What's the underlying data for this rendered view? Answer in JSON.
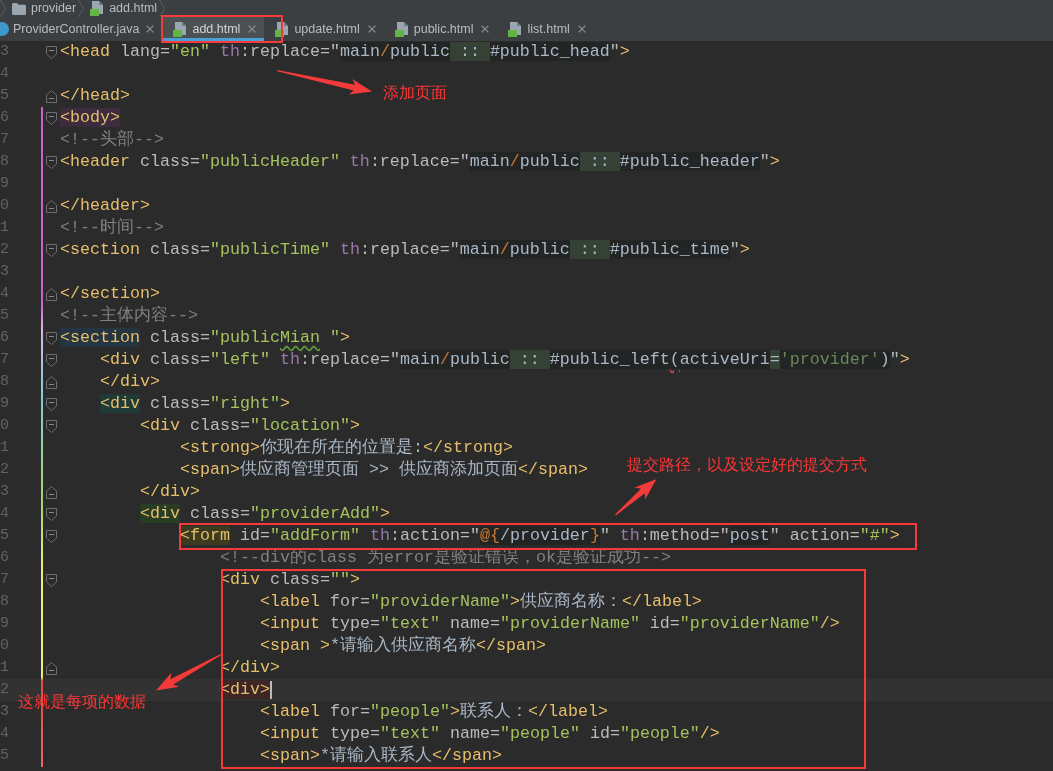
{
  "breadcrumb": [
    {
      "label": "provider",
      "kind": "folder"
    },
    {
      "label": "add.html",
      "kind": "html"
    }
  ],
  "tabs": [
    {
      "label": "ProviderController.java",
      "kind": "class",
      "selected": false
    },
    {
      "label": "add.html",
      "kind": "html",
      "selected": true
    },
    {
      "label": "update.html",
      "kind": "html",
      "selected": false
    },
    {
      "label": "public.html",
      "kind": "html",
      "selected": false
    },
    {
      "label": "list.html",
      "kind": "html",
      "selected": false
    }
  ],
  "editor": {
    "lines": [
      {
        "number": "3",
        "fold_marker": {
          "kind": "start"
        },
        "current": false,
        "segments": [
          {
            "kind": "tag",
            "text": "<head"
          },
          {
            "kind": "attr",
            "text": " lang="
          },
          {
            "kind": "str",
            "text": "\"en\""
          },
          {
            "kind": "ns",
            "text": " th"
          },
          {
            "kind": "attr",
            "text": ":replace=\""
          },
          {
            "kind": "expr",
            "text": "main"
          },
          {
            "kind": "kw",
            "text": "/"
          },
          {
            "kind": "expr",
            "text": "public"
          },
          {
            "kind": "op",
            "text": " :: "
          },
          {
            "kind": "expr",
            "text": "#public_head"
          },
          {
            "kind": "attr",
            "text": "\""
          },
          {
            "kind": "tag",
            "text": ">"
          }
        ]
      },
      {
        "number": "4",
        "current": false
      },
      {
        "number": "5",
        "fold_marker": {
          "kind": "end"
        },
        "current": false,
        "segments": [
          {
            "kind": "tag",
            "text": "</head>"
          }
        ]
      },
      {
        "number": "6",
        "fold_marker": {
          "kind": "start"
        },
        "current": false,
        "segments": [
          {
            "kind": "tagmark",
            "text": "<body>",
            "color": "#3d2b3e"
          }
        ]
      },
      {
        "number": "7",
        "current": false,
        "segments": [
          {
            "kind": "comment",
            "text": "<!--头部-->"
          }
        ]
      },
      {
        "number": "8",
        "fold_marker": {
          "kind": "start"
        },
        "current": false,
        "segments": [
          {
            "kind": "tag",
            "text": "<header"
          },
          {
            "kind": "attr",
            "text": " class="
          },
          {
            "kind": "str",
            "text": "\"publicHeader\""
          },
          {
            "kind": "ns",
            "text": " th"
          },
          {
            "kind": "attr",
            "text": ":replace=\""
          },
          {
            "kind": "expr",
            "text": "main"
          },
          {
            "kind": "kw",
            "text": "/"
          },
          {
            "kind": "expr",
            "text": "public"
          },
          {
            "kind": "op",
            "text": " :: "
          },
          {
            "kind": "expr",
            "text": "#public_header"
          },
          {
            "kind": "attr",
            "text": "\""
          },
          {
            "kind": "tag",
            "text": ">"
          }
        ]
      },
      {
        "number": "9",
        "current": false
      },
      {
        "number": "0",
        "fold_marker": {
          "kind": "end"
        },
        "current": false,
        "segments": [
          {
            "kind": "tag",
            "text": "</header>"
          }
        ]
      },
      {
        "number": "1",
        "current": false,
        "segments": [
          {
            "kind": "comment",
            "text": "<!--时间-->"
          }
        ]
      },
      {
        "number": "2",
        "fold_marker": {
          "kind": "start"
        },
        "current": false,
        "segments": [
          {
            "kind": "tag",
            "text": "<section"
          },
          {
            "kind": "attr",
            "text": " class="
          },
          {
            "kind": "str",
            "text": "\"publicTime\""
          },
          {
            "kind": "ns",
            "text": " th"
          },
          {
            "kind": "attr",
            "text": ":replace=\""
          },
          {
            "kind": "expr",
            "text": "main"
          },
          {
            "kind": "kw",
            "text": "/"
          },
          {
            "kind": "expr",
            "text": "public"
          },
          {
            "kind": "op",
            "text": " :: "
          },
          {
            "kind": "expr",
            "text": "#public_time"
          },
          {
            "kind": "attr",
            "text": "\""
          },
          {
            "kind": "tag",
            "text": ">"
          }
        ]
      },
      {
        "number": "3",
        "current": false
      },
      {
        "number": "4",
        "fold_marker": {
          "kind": "end"
        },
        "current": false,
        "segments": [
          {
            "kind": "tag",
            "text": "</section>"
          }
        ]
      },
      {
        "number": "5",
        "current": false,
        "segments": [
          {
            "kind": "comment",
            "text": "<!--主体内容-->"
          }
        ]
      },
      {
        "number": "6",
        "fold_marker": {
          "kind": "start"
        },
        "current": false,
        "segments": [
          {
            "kind": "tagmark",
            "text": "<section",
            "color": "#263542"
          },
          {
            "kind": "attr",
            "text": " class="
          },
          {
            "kind": "str",
            "text": "\"public"
          },
          {
            "kind": "typo",
            "text": "Mian"
          },
          {
            "kind": "str",
            "text": " \""
          },
          {
            "kind": "tag",
            "text": ">"
          }
        ],
        "children": [
          {
            "number": "7",
            "fold_marker": {
              "kind": "start"
            },
            "current": false,
            "segments": [
              {
                "kind": "tag",
                "text": "<div"
              },
              {
                "kind": "attr",
                "text": " class="
              },
              {
                "kind": "str",
                "text": "\"left\""
              },
              {
                "kind": "ns",
                "text": " th"
              },
              {
                "kind": "attr",
                "text": ":replace=\""
              },
              {
                "kind": "expr",
                "text": "main"
              },
              {
                "kind": "kw",
                "text": "/"
              },
              {
                "kind": "expr",
                "text": "public"
              },
              {
                "kind": "op",
                "text": " :: "
              },
              {
                "kind": "expr",
                "text": "#public_left"
              },
              {
                "kind": "error",
                "text": "("
              },
              {
                "kind": "expr",
                "text": "activeUri"
              },
              {
                "kind": "op",
                "text": "="
              },
              {
                "kind": "sq",
                "text": "'provider'"
              },
              {
                "kind": "expr",
                "text": ")"
              },
              {
                "kind": "attr",
                "text": "\""
              },
              {
                "kind": "tag",
                "text": ">"
              }
            ]
          },
          {
            "number": "8",
            "fold_marker": {
              "kind": "end"
            },
            "current": false,
            "segments": [
              {
                "kind": "tag",
                "text": "</div>"
              }
            ]
          },
          {
            "number": "9",
            "fold_marker": {
              "kind": "start"
            },
            "current": false,
            "segments": [
              {
                "kind": "tagmark",
                "text": "<div",
                "color": "#1f3a37"
              },
              {
                "kind": "attr",
                "text": " class="
              },
              {
                "kind": "str",
                "text": "\"right\""
              },
              {
                "kind": "tag",
                "text": ">"
              }
            ],
            "children": [
              {
                "number": "0",
                "fold_marker": {
                  "kind": "start"
                },
                "current": false,
                "segments": [
                  {
                    "kind": "tag",
                    "text": "<div"
                  },
                  {
                    "kind": "attr",
                    "text": " class="
                  },
                  {
                    "kind": "str",
                    "text": "\"location\""
                  },
                  {
                    "kind": "tag",
                    "text": ">"
                  }
                ],
                "children": [
                  {
                    "number": "1",
                    "current": false,
                    "segments": [
                      {
                        "kind": "tag",
                        "text": "<strong>"
                      },
                      {
                        "kind": "text",
                        "text": "你现在所在的位置是:"
                      },
                      {
                        "kind": "tag",
                        "text": "</strong>"
                      }
                    ]
                  },
                  {
                    "number": "2",
                    "current": false,
                    "segments": [
                      {
                        "kind": "tag",
                        "text": "<span>"
                      },
                      {
                        "kind": "text",
                        "text": "供应商管理页面 >> 供应商添加页面"
                      },
                      {
                        "kind": "tag",
                        "text": "</span>"
                      }
                    ]
                  }
                ]
              },
              {
                "number": "3",
                "fold_marker": {
                  "kind": "end"
                },
                "current": false,
                "segments": [
                  {
                    "kind": "tag",
                    "text": "</div>"
                  }
                ]
              },
              {
                "number": "4",
                "fold_marker": {
                  "kind": "start"
                },
                "current": false,
                "segments": [
                  {
                    "kind": "tagmark",
                    "text": "<div",
                    "color": "#283d23"
                  },
                  {
                    "kind": "attr",
                    "text": " class="
                  },
                  {
                    "kind": "str",
                    "text": "\"providerAdd\""
                  },
                  {
                    "kind": "tag",
                    "text": ">"
                  }
                ],
                "children": [
                  {
                    "number": "5",
                    "fold_marker": {
                      "kind": "start"
                    },
                    "current": false,
                    "segments": [
                      {
                        "kind": "tagmark",
                        "text": "<form",
                        "color": "#3d3b1f"
                      },
                      {
                        "kind": "attr",
                        "text": " id="
                      },
                      {
                        "kind": "str",
                        "text": "\"addForm\""
                      },
                      {
                        "kind": "ns",
                        "text": " th"
                      },
                      {
                        "kind": "attr",
                        "text": ":action=\""
                      },
                      {
                        "kind": "kw",
                        "text": "@{"
                      },
                      {
                        "kind": "expr",
                        "text": "/provider"
                      },
                      {
                        "kind": "kw",
                        "text": "}"
                      },
                      {
                        "kind": "attr",
                        "text": "\""
                      },
                      {
                        "kind": "ns",
                        "text": " th"
                      },
                      {
                        "kind": "attr",
                        "text": ":method=\""
                      },
                      {
                        "kind": "expr",
                        "text": "post"
                      },
                      {
                        "kind": "attr",
                        "text": "\" action="
                      },
                      {
                        "kind": "str",
                        "text": "\"#\""
                      },
                      {
                        "kind": "tag",
                        "text": ">"
                      }
                    ],
                    "children": [
                      {
                        "number": "6",
                        "current": false,
                        "segments": [
                          {
                            "kind": "comment",
                            "text": "<!--div的class 为error是验证错误，ok是验证成功-->"
                          }
                        ]
                      },
                      {
                        "number": "7",
                        "fold_marker": {
                          "kind": "start"
                        },
                        "current": false,
                        "segments": [
                          {
                            "kind": "tag",
                            "text": "<div"
                          },
                          {
                            "kind": "attr",
                            "text": " class="
                          },
                          {
                            "kind": "str",
                            "text": "\"\""
                          },
                          {
                            "kind": "tag",
                            "text": ">"
                          }
                        ],
                        "children": [
                          {
                            "number": "8",
                            "current": false,
                            "segments": [
                              {
                                "kind": "tag",
                                "text": "<label"
                              },
                              {
                                "kind": "attr",
                                "text": " for="
                              },
                              {
                                "kind": "str",
                                "text": "\"providerName\""
                              },
                              {
                                "kind": "tag",
                                "text": ">"
                              },
                              {
                                "kind": "text",
                                "text": "供应商名称："
                              },
                              {
                                "kind": "tag",
                                "text": "</label>"
                              }
                            ]
                          },
                          {
                            "number": "9",
                            "current": false,
                            "segments": [
                              {
                                "kind": "tag",
                                "text": "<input"
                              },
                              {
                                "kind": "attr",
                                "text": " type="
                              },
                              {
                                "kind": "str",
                                "text": "\"text\""
                              },
                              {
                                "kind": "attr",
                                "text": " name="
                              },
                              {
                                "kind": "str",
                                "text": "\"providerName\""
                              },
                              {
                                "kind": "attr",
                                "text": " id="
                              },
                              {
                                "kind": "str",
                                "text": "\"providerName\""
                              },
                              {
                                "kind": "tag",
                                "text": "/>"
                              }
                            ]
                          },
                          {
                            "number": "0",
                            "current": false,
                            "segments": [
                              {
                                "kind": "tag",
                                "text": "<span >"
                              },
                              {
                                "kind": "text",
                                "text": "*请输入供应商名称"
                              },
                              {
                                "kind": "tag",
                                "text": "</span>"
                              }
                            ]
                          }
                        ]
                      },
                      {
                        "number": "1",
                        "fold_marker": {
                          "kind": "end"
                        },
                        "current": false,
                        "segments": [
                          {
                            "kind": "tag",
                            "text": "</div>"
                          }
                        ]
                      },
                      {
                        "number": "2",
                        "current": true,
                        "segments": [
                          {
                            "kind": "tagmark",
                            "text": "<div>",
                            "color": "#3e2626"
                          }
                        ],
                        "children": [
                          {
                            "number": "3",
                            "current": false,
                            "segments": [
                              {
                                "kind": "tag",
                                "text": "<label"
                              },
                              {
                                "kind": "attr",
                                "text": " for="
                              },
                              {
                                "kind": "str",
                                "text": "\"people\""
                              },
                              {
                                "kind": "tag",
                                "text": ">"
                              },
                              {
                                "kind": "text",
                                "text": "联系人："
                              },
                              {
                                "kind": "tag",
                                "text": "</label>"
                              }
                            ]
                          },
                          {
                            "number": "4",
                            "current": false,
                            "segments": [
                              {
                                "kind": "tag",
                                "text": "<input"
                              },
                              {
                                "kind": "attr",
                                "text": " type="
                              },
                              {
                                "kind": "str",
                                "text": "\"text\""
                              },
                              {
                                "kind": "attr",
                                "text": " name="
                              },
                              {
                                "kind": "str",
                                "text": "\"people\""
                              },
                              {
                                "kind": "attr",
                                "text": " id="
                              },
                              {
                                "kind": "str",
                                "text": "\"people\""
                              },
                              {
                                "kind": "tag",
                                "text": "/>"
                              }
                            ]
                          },
                          {
                            "number": "5",
                            "current": false,
                            "segments": [
                              {
                                "kind": "tag",
                                "text": "<span>"
                              },
                              {
                                "kind": "text",
                                "text": "*请输入联系人"
                              },
                              {
                                "kind": "tag",
                                "text": "</span>"
                              }
                            ]
                          }
                        ]
                      }
                    ]
                  }
                ]
              }
            ]
          }
        ]
      }
    ]
  },
  "annotations": [
    {
      "text": "添加页面"
    },
    {
      "text": "提交路径，以及设定好的提交方式"
    },
    {
      "text": "这就是每项的数据"
    }
  ]
}
